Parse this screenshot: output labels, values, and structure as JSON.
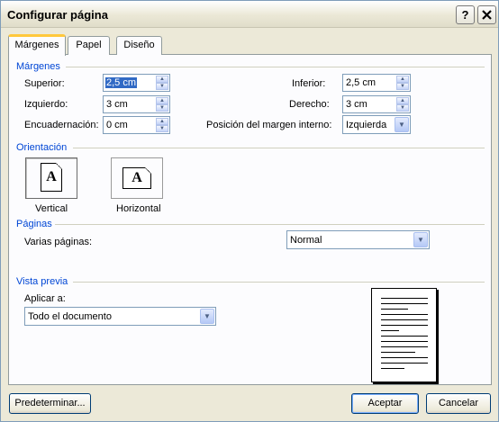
{
  "window": {
    "title": "Configurar página",
    "help_label": "?",
    "close_label": "✕"
  },
  "tabs": [
    {
      "label": "Márgenes",
      "active": true
    },
    {
      "label": "Papel",
      "active": false
    },
    {
      "label": "Diseño",
      "active": false
    }
  ],
  "margins": {
    "section_title": "Márgenes",
    "superior": {
      "label": "Superior:",
      "value": "2,5 cm"
    },
    "izquierdo": {
      "label": "Izquierdo:",
      "value": "3 cm"
    },
    "encuadernacion": {
      "label": "Encuadernación:",
      "value": "0 cm"
    },
    "inferior": {
      "label": "Inferior:",
      "value": "2,5 cm"
    },
    "derecho": {
      "label": "Derecho:",
      "value": "3 cm"
    },
    "posicion": {
      "label": "Posición del margen interno:",
      "value": "Izquierda"
    }
  },
  "orientation": {
    "section_title": "Orientación",
    "vertical_label": "Vertical",
    "horizontal_label": "Horizontal",
    "icon_letter": "A",
    "selected": "vertical"
  },
  "pages": {
    "section_title": "Páginas",
    "varias_label": "Varias páginas:",
    "varias_value": "Normal"
  },
  "preview": {
    "section_title": "Vista previa",
    "apply_label": "Aplicar a:",
    "apply_value": "Todo el documento"
  },
  "buttons": {
    "default_label": "Predeterminar...",
    "ok_label": "Aceptar",
    "cancel_label": "Cancelar"
  },
  "colors": {
    "accent_section": "#0046d5",
    "tab_highlight": "#ffc83c",
    "dialog_bg": "#ece9d8",
    "selection": "#316ac5"
  }
}
